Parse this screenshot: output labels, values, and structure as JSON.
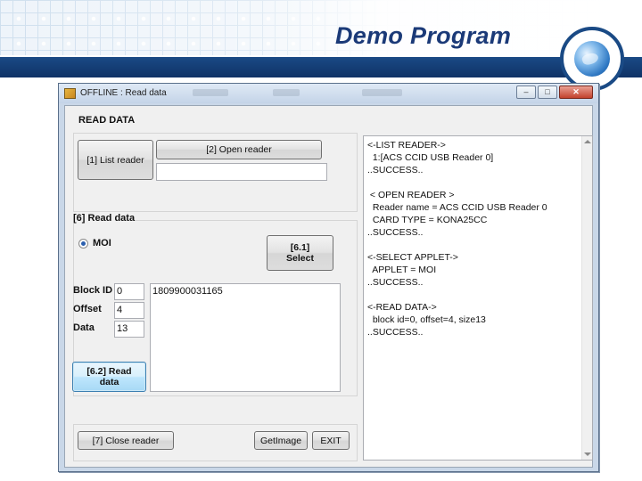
{
  "slide": {
    "title": "Demo Program"
  },
  "window": {
    "title": "OFFLINE : Read data",
    "minimize_glyph": "–",
    "maximize_glyph": "□",
    "close_glyph": "✕"
  },
  "read_data": {
    "section_title": "READ DATA",
    "list_reader_label": "[1] List reader",
    "open_reader_label": "[2] Open reader",
    "reader_field_value": ""
  },
  "read_group": {
    "title": "[6] Read data",
    "radio_label": "MOI",
    "radio_selected": true,
    "select_label_line1": "[6.1]",
    "select_label_line2": "Select",
    "block_id_label": "Block ID",
    "block_id_value": "0",
    "offset_label": "Offset",
    "offset_value": "4",
    "data_label": "Data",
    "data_value": "13",
    "read_button_line1": "[6.2] Read",
    "read_button_line2": "data",
    "output_value": "1809900031165"
  },
  "footer": {
    "close_reader_label": "[7] Close reader",
    "get_image_label": "GetImage",
    "exit_label": "EXIT"
  },
  "log": {
    "lines": [
      "<-LIST READER->",
      "  1:[ACS CCID USB Reader 0]",
      "..SUCCESS..",
      "",
      " < OPEN READER >",
      "  Reader name = ACS CCID USB Reader 0",
      "  CARD TYPE = KONA25CC",
      "..SUCCESS..",
      "",
      "<-SELECT APPLET->",
      "  APPLET = MOI",
      "..SUCCESS..",
      "",
      "<-READ DATA->",
      "  block id=0, offset=4, size13",
      "..SUCCESS.."
    ]
  },
  "icons": {
    "app": "app-icon",
    "globe": "globe-logo-icon"
  }
}
